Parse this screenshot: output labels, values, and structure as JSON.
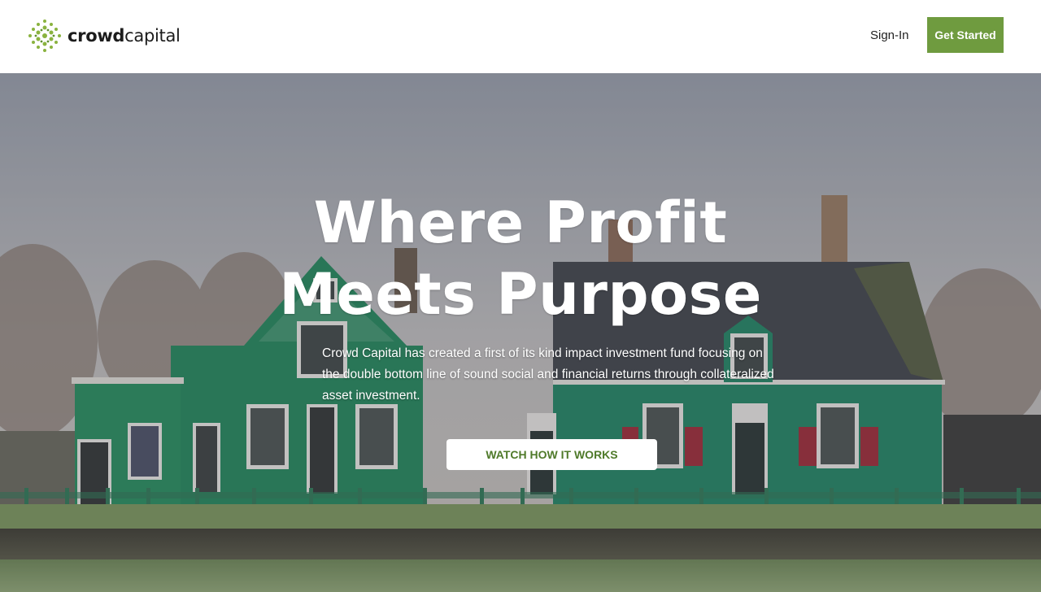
{
  "header": {
    "logo_bold": "crowd",
    "logo_light": "capital",
    "signin_label": "Sign-In",
    "get_started_label": "Get Started"
  },
  "hero": {
    "headline_line1": "Where Profit",
    "headline_line2": "Meets Purpose",
    "description": "Crowd Capital has created a first of its kind impact investment fund focusing on the double bottom line of sound social and financial returns through collateralized asset investment.",
    "watch_label": "WATCH HOW IT WORKS"
  },
  "colors": {
    "brand_green": "#6f9b3f",
    "button_text_green": "#4f7a2a",
    "header_bg": "#ffffff"
  }
}
